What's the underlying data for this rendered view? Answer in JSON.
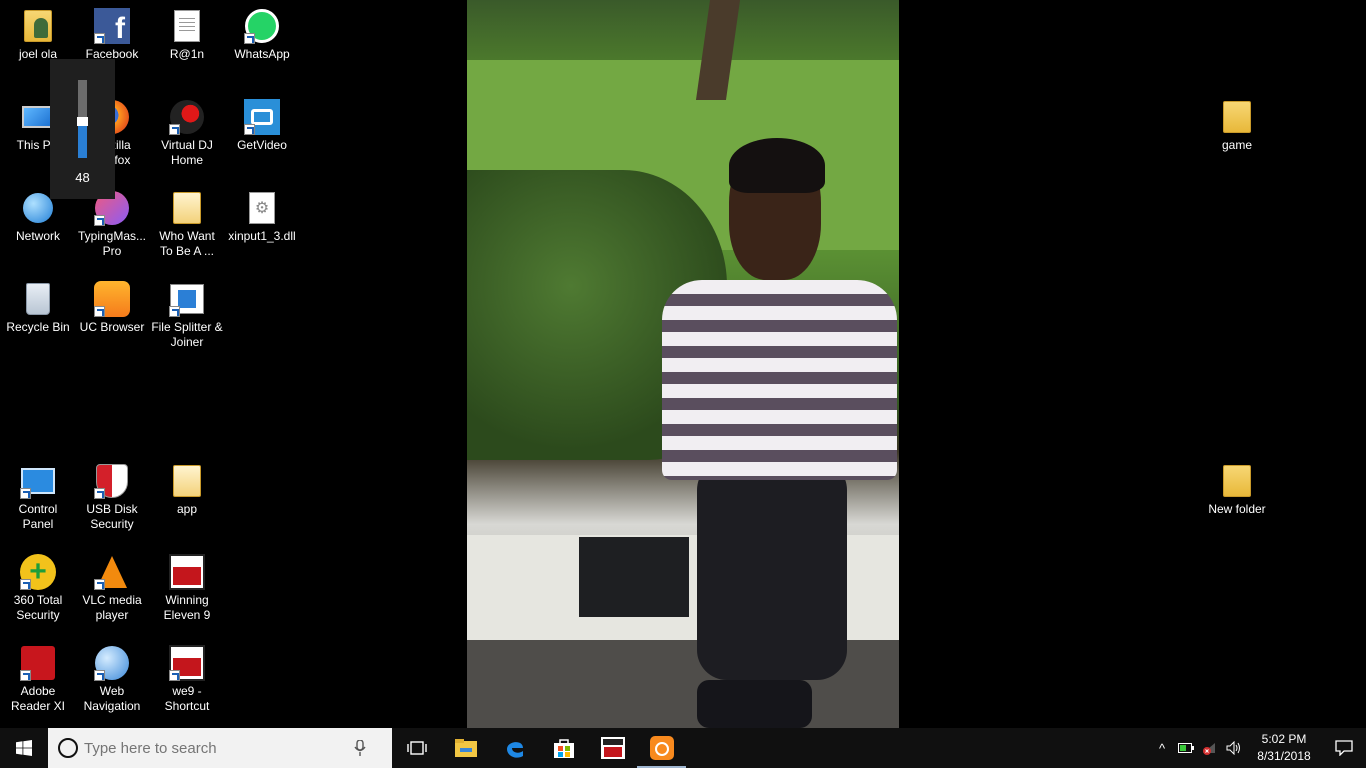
{
  "desktop": {
    "icons": [
      {
        "label": "joel ola",
        "icon": "user-folder-icon"
      },
      {
        "label": "Facebook",
        "icon": "facebook-icon"
      },
      {
        "label": "R@1n",
        "icon": "document-icon"
      },
      {
        "label": "WhatsApp",
        "icon": "whatsapp-icon"
      },
      {
        "label": "This PC",
        "icon": "computer-icon"
      },
      {
        "label": "Mozilla\nFirefox",
        "icon": "firefox-icon"
      },
      {
        "label": "Virtual DJ\nHome",
        "icon": "virtual-dj-icon"
      },
      {
        "label": "GetVideo",
        "icon": "getvideo-icon"
      },
      {
        "label": "Network",
        "icon": "network-icon"
      },
      {
        "label": "TypingMas...\nPro",
        "icon": "typingmaster-icon"
      },
      {
        "label": "Who Want\nTo Be A ...",
        "icon": "folder-icon"
      },
      {
        "label": "xinput1_3.dll",
        "icon": "dll-file-icon"
      },
      {
        "label": "Recycle Bin",
        "icon": "recycle-bin-icon"
      },
      {
        "label": "UC Browser",
        "icon": "uc-browser-icon"
      },
      {
        "label": "File Splitter &\nJoiner",
        "icon": "file-splitter-icon"
      },
      {
        "label": "Control\nPanel",
        "icon": "control-panel-icon"
      },
      {
        "label": "USB Disk\nSecurity",
        "icon": "usb-disk-security-icon"
      },
      {
        "label": "app",
        "icon": "folder-icon"
      },
      {
        "label": "360 Total\nSecurity",
        "icon": "360-security-icon"
      },
      {
        "label": "VLC media\nplayer",
        "icon": "vlc-icon"
      },
      {
        "label": "Winning\nEleven 9",
        "icon": "winning-eleven-icon"
      },
      {
        "label": "Adobe\nReader XI",
        "icon": "adobe-reader-icon"
      },
      {
        "label": "Web\nNavigation",
        "icon": "web-navigation-icon"
      },
      {
        "label": "we9 -\nShortcut",
        "icon": "winning-eleven-icon"
      },
      {
        "label": "game",
        "icon": "folder-icon"
      },
      {
        "label": "New folder",
        "icon": "folder-icon"
      }
    ]
  },
  "volume": {
    "value": "48",
    "level": 0.48
  },
  "taskbar": {
    "search_placeholder": "Type here to search",
    "pinned": [
      "task-view-icon",
      "file-explorer-icon",
      "edge-icon",
      "store-icon",
      "winning-eleven-icon",
      "uc-browser-icon"
    ],
    "time": "5:02 PM",
    "date": "8/31/2018"
  },
  "colors": {
    "accent": "#2a7fd4",
    "taskbar": "#101010",
    "desktop_bg": "#000000"
  }
}
